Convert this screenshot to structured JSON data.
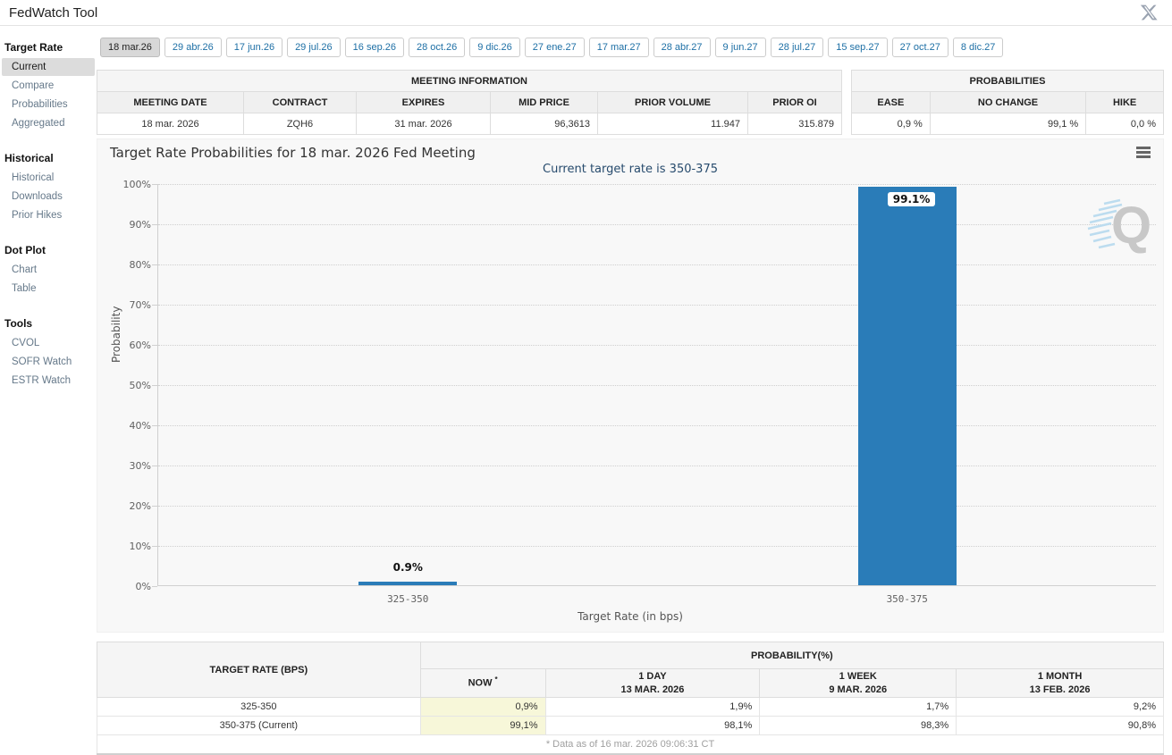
{
  "header": {
    "title": "FedWatch Tool"
  },
  "icons": {
    "close": "x-logo-icon",
    "chart_menu": "hamburger-menu-icon",
    "watermark": "quikstrike-q-watermark"
  },
  "colors": {
    "bar": "#2a7cb8",
    "now_highlight": "#f7f7d9",
    "tab_selected_bg": "#d8d8d8",
    "subtitle": "#274b6d"
  },
  "tabs": [
    {
      "label": "18 mar.26",
      "selected": true
    },
    {
      "label": "29 abr.26",
      "selected": false
    },
    {
      "label": "17 jun.26",
      "selected": false
    },
    {
      "label": "29 jul.26",
      "selected": false
    },
    {
      "label": "16 sep.26",
      "selected": false
    },
    {
      "label": "28 oct.26",
      "selected": false
    },
    {
      "label": "9 dic.26",
      "selected": false
    },
    {
      "label": "27 ene.27",
      "selected": false
    },
    {
      "label": "17 mar.27",
      "selected": false
    },
    {
      "label": "28 abr.27",
      "selected": false
    },
    {
      "label": "9 jun.27",
      "selected": false
    },
    {
      "label": "28 jul.27",
      "selected": false
    },
    {
      "label": "15 sep.27",
      "selected": false
    },
    {
      "label": "27 oct.27",
      "selected": false
    },
    {
      "label": "8 dic.27",
      "selected": false
    }
  ],
  "sidebar": {
    "sections": [
      {
        "title": "Target Rate",
        "items": [
          {
            "label": "Current",
            "selected": true
          },
          {
            "label": "Compare",
            "selected": false
          },
          {
            "label": "Probabilities",
            "selected": false
          },
          {
            "label": "Aggregated",
            "selected": false
          }
        ]
      },
      {
        "title": "Historical",
        "items": [
          {
            "label": "Historical",
            "selected": false
          },
          {
            "label": "Downloads",
            "selected": false
          },
          {
            "label": "Prior Hikes",
            "selected": false
          }
        ]
      },
      {
        "title": "Dot Plot",
        "items": [
          {
            "label": "Chart",
            "selected": false
          },
          {
            "label": "Table",
            "selected": false
          }
        ]
      },
      {
        "title": "Tools",
        "items": [
          {
            "label": "CVOL",
            "selected": false
          },
          {
            "label": "SOFR Watch",
            "selected": false
          },
          {
            "label": "ESTR Watch",
            "selected": false
          }
        ]
      }
    ]
  },
  "meeting_info": {
    "title": "MEETING INFORMATION",
    "columns": [
      "MEETING DATE",
      "CONTRACT",
      "EXPIRES",
      "MID PRICE",
      "PRIOR VOLUME",
      "PRIOR OI"
    ],
    "values": [
      "18 mar. 2026",
      "ZQH6",
      "31 mar. 2026",
      "96,3613",
      "11.947",
      "315.879"
    ]
  },
  "probabilities_summary": {
    "title": "PROBABILITIES",
    "columns": [
      "EASE",
      "NO CHANGE",
      "HIKE"
    ],
    "values": [
      "0,9 %",
      "99,1 %",
      "0,0 %"
    ]
  },
  "chart_data": {
    "type": "bar",
    "title": "Target Rate Probabilities for 18 mar. 2026 Fed Meeting",
    "subtitle": "Current target rate is 350-375",
    "categories": [
      "325-350",
      "350-375"
    ],
    "values": [
      0.9,
      99.1
    ],
    "data_labels": [
      "0.9%",
      "99.1%"
    ],
    "xlabel": "Target Rate (in bps)",
    "ylabel": "Probability",
    "ylim": [
      0,
      100
    ],
    "ytick_step": 10,
    "yticks": [
      "0%",
      "10%",
      "20%",
      "30%",
      "40%",
      "50%",
      "60%",
      "70%",
      "80%",
      "90%",
      "100%"
    ],
    "grid": "dotted horizontal",
    "legend_position": "none",
    "bar_color": "#2a7cb8",
    "watermark_letter": "Q"
  },
  "probability_table": {
    "left_header": "TARGET RATE (BPS)",
    "group_header": "PROBABILITY(%)",
    "sub_columns": [
      {
        "line1": "NOW",
        "sup": "*",
        "line2": ""
      },
      {
        "line1": "1 DAY",
        "sup": "",
        "line2": "13 MAR. 2026"
      },
      {
        "line1": "1 WEEK",
        "sup": "",
        "line2": "9 MAR. 2026"
      },
      {
        "line1": "1 MONTH",
        "sup": "",
        "line2": "13 FEB. 2026"
      }
    ],
    "rows": [
      {
        "target": "325-350",
        "values": [
          "0,9%",
          "1,9%",
          "1,7%",
          "9,2%"
        ]
      },
      {
        "target": "350-375 (Current)",
        "values": [
          "99,1%",
          "98,1%",
          "98,3%",
          "90,8%"
        ]
      }
    ],
    "footnote": "* Data as of 16 mar. 2026 09:06:31 CT"
  }
}
